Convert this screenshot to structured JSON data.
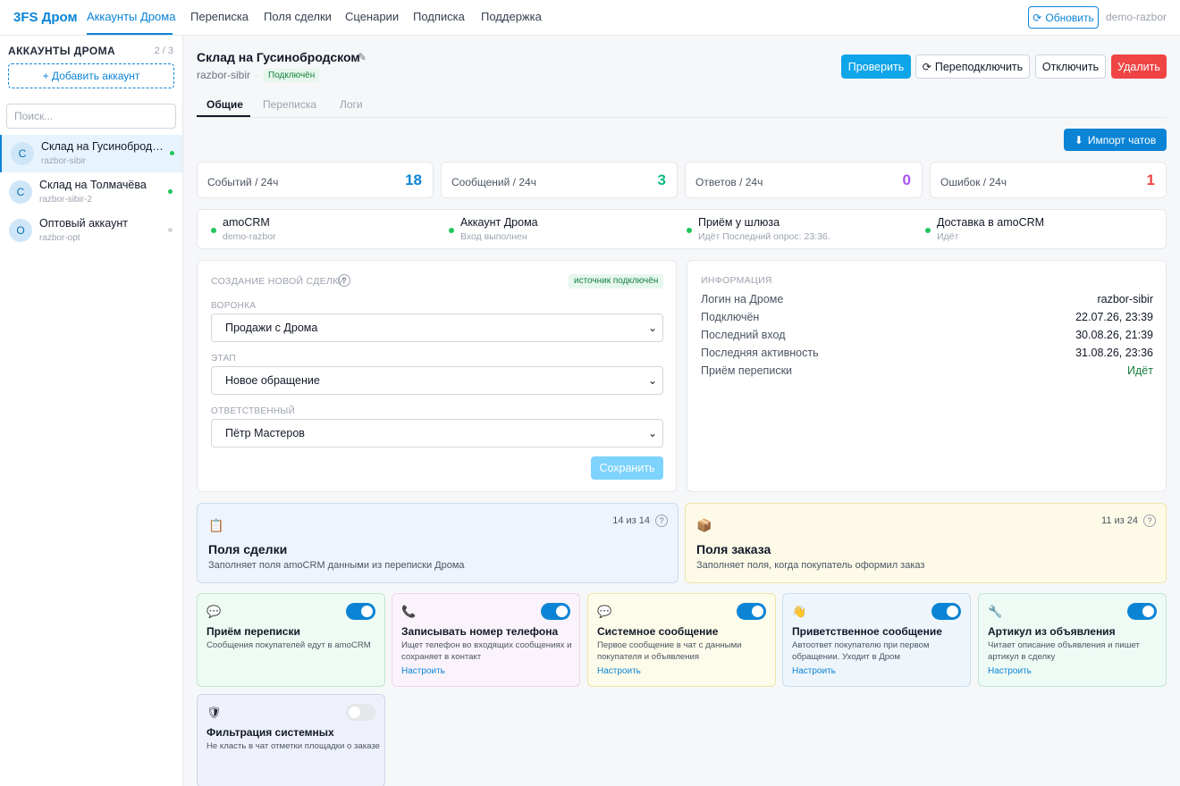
{
  "app": {
    "brand": "3FS Дром",
    "nav": [
      "Аккаунты Дрома",
      "Переписка",
      "Поля сделки",
      "Сценарии",
      "Подписка",
      "Поддержка"
    ],
    "refresh_label": "Обновить",
    "user": "demo-razbor"
  },
  "sidebar": {
    "title": "АККАУНТЫ ДРОМА",
    "count": "2 / 3",
    "add_label": "+ Добавить аккаунт",
    "search_placeholder": "Поиск...",
    "accounts": [
      {
        "avatar": "С",
        "name": "Склад на Гусинобродском",
        "login": "razbor-sibir",
        "status_color": "#22c55e"
      },
      {
        "avatar": "С",
        "name": "Склад на Толмачёва",
        "login": "razbor-sibir-2",
        "status_color": "#22c55e"
      },
      {
        "avatar": "О",
        "name": "Оптовый аккаунт",
        "login": "razbor-opt",
        "status_color": "#d1d5db"
      }
    ]
  },
  "header": {
    "title": "Склад на Гусинобродском",
    "login": "razbor-sibir",
    "separator": "·",
    "status": "Подключён",
    "buttons": {
      "check": "Проверить",
      "reconnect": "Переподключить",
      "disconnect": "Отключить",
      "delete": "Удалить"
    }
  },
  "tabs": [
    "Общие",
    "Переписка",
    "Логи"
  ],
  "import_label": "Импорт чатов",
  "stats": [
    {
      "label": "Событий / 24ч",
      "value": "18",
      "color": "#0b84d6"
    },
    {
      "label": "Сообщений / 24ч",
      "value": "3",
      "color": "#10b981"
    },
    {
      "label": "Ответов / 24ч",
      "value": "0",
      "color": "#a855f7"
    },
    {
      "label": "Ошибок / 24ч",
      "value": "1",
      "color": "#ef4444"
    }
  ],
  "health": [
    {
      "title": "amoCRM",
      "sub": "demo-razbor"
    },
    {
      "title": "Аккаунт Дрома",
      "sub": "Вход выполнен"
    },
    {
      "title": "Приём у шлюза",
      "sub": "Идёт Последний опрос: 23:36."
    },
    {
      "title": "Доставка в amoCRM",
      "sub": "Идёт"
    }
  ],
  "deal": {
    "caption": "СОЗДАНИЕ НОВОЙ СДЕЛКИ",
    "source_badge": "источник подключён",
    "fields": [
      {
        "label": "ВОРОНКА",
        "value": "Продажи с Дрома"
      },
      {
        "label": "ЭТАП",
        "value": "Новое обращение"
      },
      {
        "label": "ОТВЕТСТВЕННЫЙ",
        "value": "Пётр Мастеров"
      }
    ],
    "save_label": "Сохранить"
  },
  "info": {
    "caption": "ИНФОРМАЦИЯ",
    "rows": [
      {
        "k": "Логин на Дроме",
        "v": "razbor-sibir",
        "color": "#111827"
      },
      {
        "k": "Подключён",
        "v": "22.07.26, 23:39",
        "color": "#111827"
      },
      {
        "k": "Последний вход",
        "v": "30.08.26, 21:39",
        "color": "#111827"
      },
      {
        "k": "Последняя активность",
        "v": "31.08.26, 23:36",
        "color": "#111827"
      },
      {
        "k": "Приём переписки",
        "v": "Идёт",
        "color": "#15803d"
      }
    ]
  },
  "big_cards": [
    {
      "icon": "clipboard-icon",
      "count": "14 из 14",
      "title": "Поля сделки",
      "desc": "Заполняет поля amoCRM данными из переписки Дрома"
    },
    {
      "icon": "package-icon",
      "count": "11 из 24",
      "title": "Поля заказа",
      "desc": "Заполняет поля, когда покупатель оформил заказ"
    }
  ],
  "features": [
    {
      "icon": "speech-bubble-icon",
      "title": "Приём переписки",
      "desc": "Сообщения покупателей едут в amoCRM",
      "link": "",
      "on": true
    },
    {
      "icon": "phone-icon",
      "title": "Записывать номер телефона",
      "desc": "Ищет телефон во входящих сообщениях и сохраняет в контакт",
      "link": "Настроить",
      "on": true
    },
    {
      "icon": "speech-bubble-icon",
      "title": "Системное сообщение",
      "desc": "Первое сообщение в чат с данными покупателя и объявления",
      "link": "Настроить",
      "on": true
    },
    {
      "icon": "waving-hand-icon",
      "title": "Приветственное сообщение",
      "desc": "Автоответ покупателю при первом обращении. Уходит в Дром",
      "link": "Настроить",
      "on": true
    },
    {
      "icon": "wrench-icon",
      "title": "Артикул из объявления",
      "desc": "Читает описание объявления и пишет артикул в сделку",
      "link": "Настроить",
      "on": true
    },
    {
      "icon": "shield-icon",
      "title": "Фильтрация системных",
      "desc": "Не класть в чат отметки площадки о заказе",
      "link": "",
      "on": false
    }
  ]
}
